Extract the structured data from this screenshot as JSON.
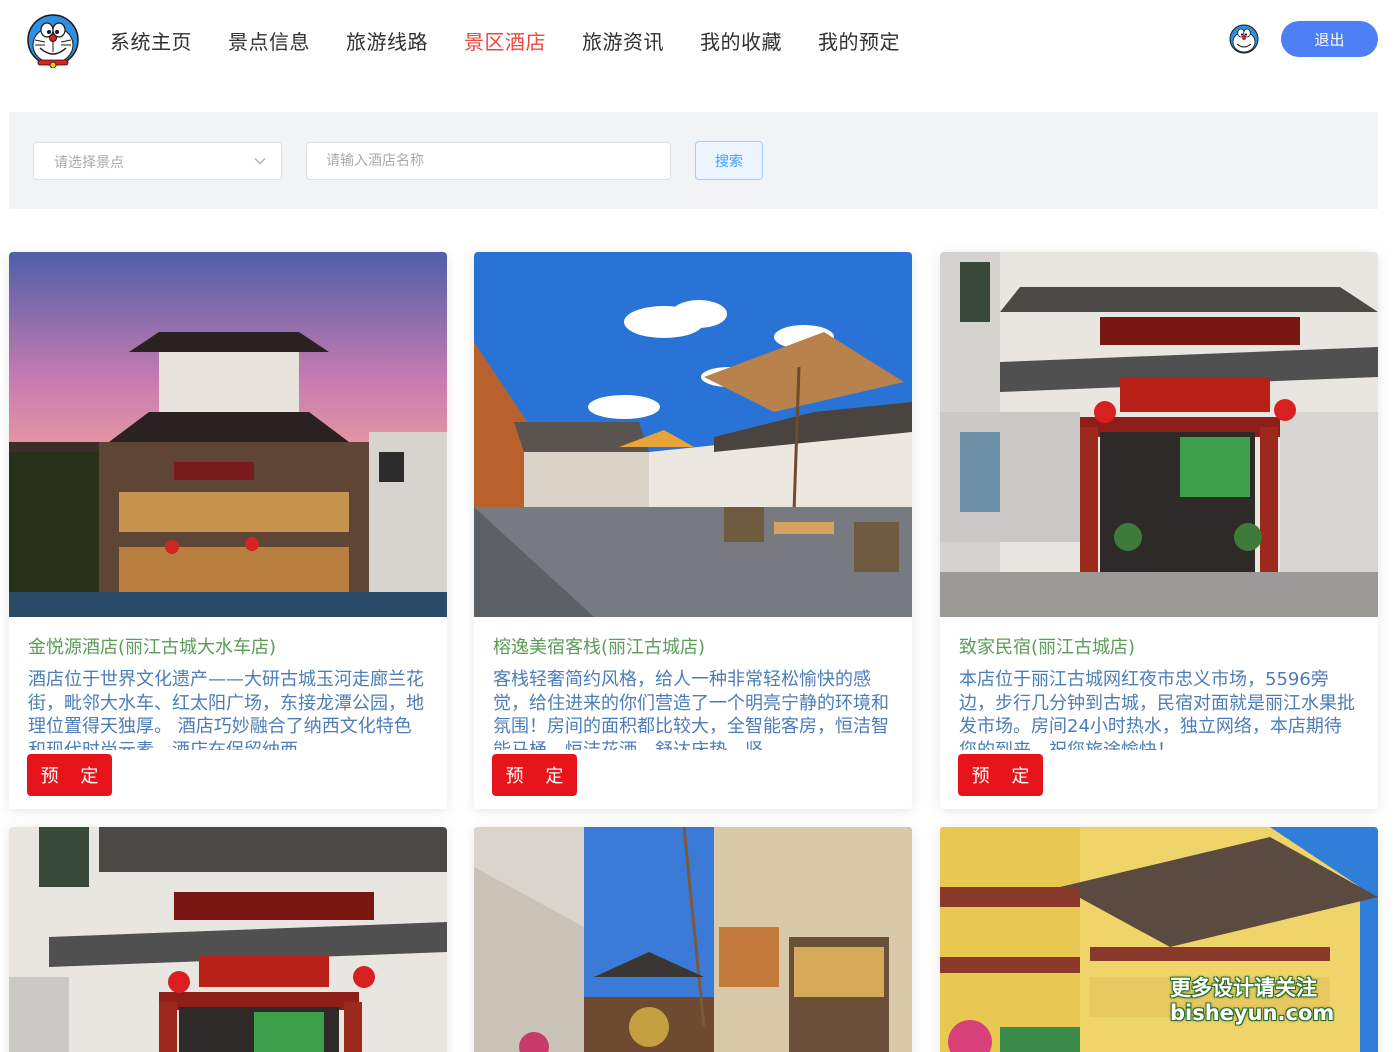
{
  "header": {
    "nav": [
      {
        "label": "系统主页"
      },
      {
        "label": "景点信息"
      },
      {
        "label": "旅游线路"
      },
      {
        "label": "景区酒店",
        "active": true
      },
      {
        "label": "旅游资讯"
      },
      {
        "label": "我的收藏"
      },
      {
        "label": "我的预定"
      }
    ],
    "logout_label": "退出",
    "logo_icon": "doraemon-logo-icon",
    "avatar_icon": "doraemon-avatar-icon"
  },
  "search": {
    "select_placeholder": "请选择景点",
    "hotel_placeholder": "请输入酒店名称",
    "button_label": "搜索"
  },
  "hotels": [
    {
      "name": "金悦源酒店(丽江古城大水车店)",
      "description": "酒店位于世界文化遗产——大研古城玉河走廊兰花街，毗邻大水车、红太阳广场，东接龙潭公园，地理位置得天独厚。 酒店巧妙融合了纳西文化特色和现代时尚元素，酒店在保留纳西",
      "book_label": "预 定"
    },
    {
      "name": "榕逸美宿客栈(丽江古城店)",
      "description": "客栈轻奢简约风格，给人一种非常轻松愉快的感觉，给住进来的你们营造了一个明亮宁静的环境和氛围！房间的面积都比较大，全智能客房，恒洁智能马桶、恒洁花洒、舒达床垫、坚",
      "book_label": "预 定"
    },
    {
      "name": "致家民宿(丽江古城店)",
      "description": "本店位于丽江古城网红夜市忠义市场，5596旁边，步行几分钟到古城，民宿对面就是丽江水果批发市场。房间24小时热水，独立网络，本店期待您的到来，祝您旅途愉快！",
      "book_label": "预 定"
    }
  ],
  "colors": {
    "nav_active": "#f0463c",
    "logout_bg": "#4d7ff5",
    "card_title": "#5c9b58",
    "card_desc": "#4d7db8",
    "book_bg": "#e8141c"
  },
  "watermark": {
    "line1": "更多设计请关注",
    "line2": "bisheyun.com"
  }
}
